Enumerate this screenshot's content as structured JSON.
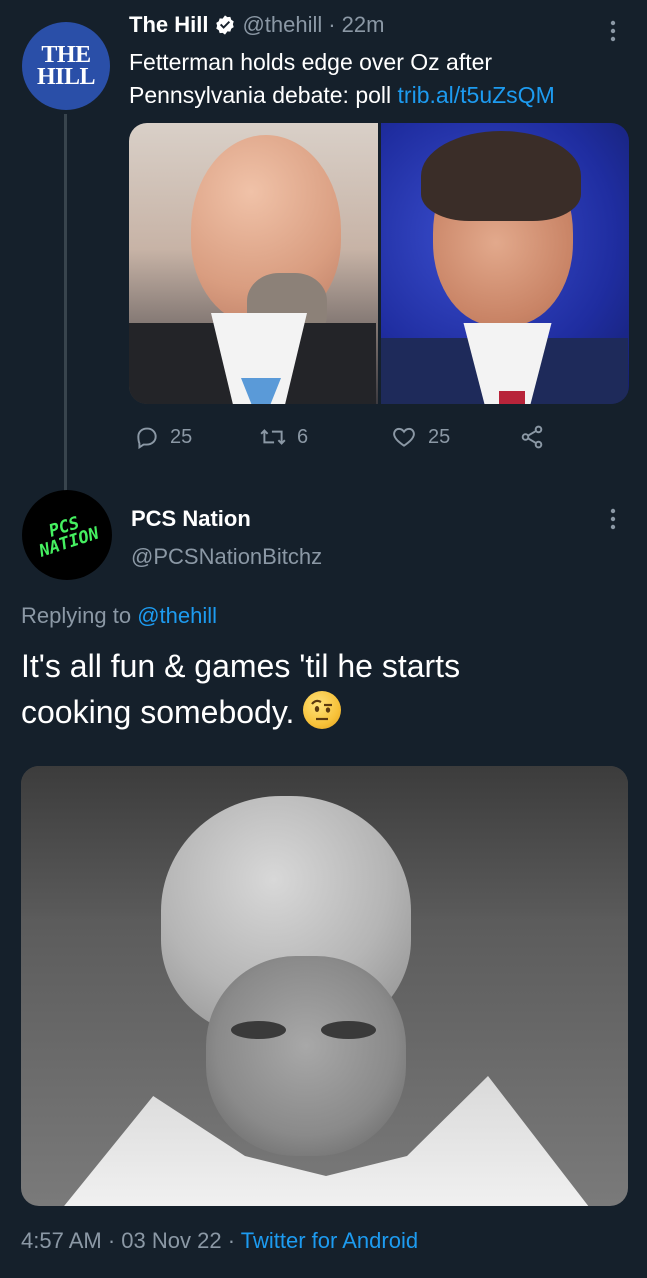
{
  "tweet1": {
    "avatar_text_line1": "THE",
    "avatar_text_line2": "HILL",
    "name": "The Hill",
    "handle": "@thehill",
    "separator": "·",
    "time": "22m",
    "text_line1": "Fetterman holds edge over Oz after",
    "text_line2_prefix": "Pennsylvania debate: poll ",
    "link": "trib.al/t5uZsQM",
    "replies": "25",
    "retweets": "6",
    "likes": "25"
  },
  "tweet2": {
    "avatar_text_line1": "PCS",
    "avatar_text_line2": "NATION",
    "name": "PCS Nation",
    "handle": "@PCSNationBitchz",
    "replying_prefix": "Replying to ",
    "replying_handle": "@thehill",
    "text_line1": "It's all fun & games 'til he starts",
    "text_line2": "cooking somebody.",
    "time": "4:57 AM",
    "sep1": "·",
    "date": "03 Nov 22",
    "sep2": "·",
    "client": "Twitter for Android"
  },
  "colors": {
    "background": "#15202b",
    "link": "#1d9bf0",
    "muted": "#8b98a5",
    "verified": "#ffffff"
  },
  "icons": [
    "verified-badge-icon",
    "more-icon",
    "reply-icon",
    "retweet-icon",
    "like-icon",
    "share-icon",
    "raised-eyebrow-emoji"
  ]
}
